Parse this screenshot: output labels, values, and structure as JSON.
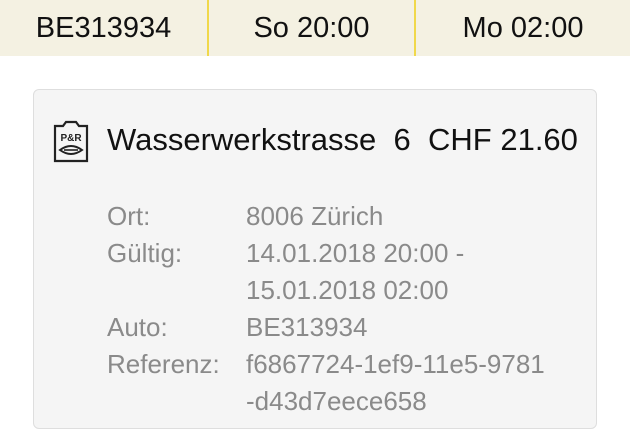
{
  "header": {
    "plate": "BE313934",
    "start": "So 20:00",
    "end": "Mo 02:00"
  },
  "card": {
    "icon": "park-and-ride-icon",
    "title": {
      "street": "Wasserwerkstrasse",
      "number": "6",
      "price": "CHF 21.60"
    },
    "details": [
      {
        "key": "Ort:",
        "lines": [
          "8006  Zürich"
        ]
      },
      {
        "key": "Gültig:",
        "lines": [
          "14.01.2018 20:00 -",
          "15.01.2018 02:00"
        ]
      },
      {
        "key": "Auto:",
        "lines": [
          "BE313934"
        ]
      },
      {
        "key": "Referenz:",
        "lines": [
          "f6867724-1ef9-11e5-9781",
          "-d43d7eece658"
        ]
      }
    ]
  },
  "colors": {
    "header_bg": "#f4f1e2",
    "divider": "#f0d84a",
    "card_bg": "#f5f5f5",
    "label_gray": "#8a8a8a"
  }
}
